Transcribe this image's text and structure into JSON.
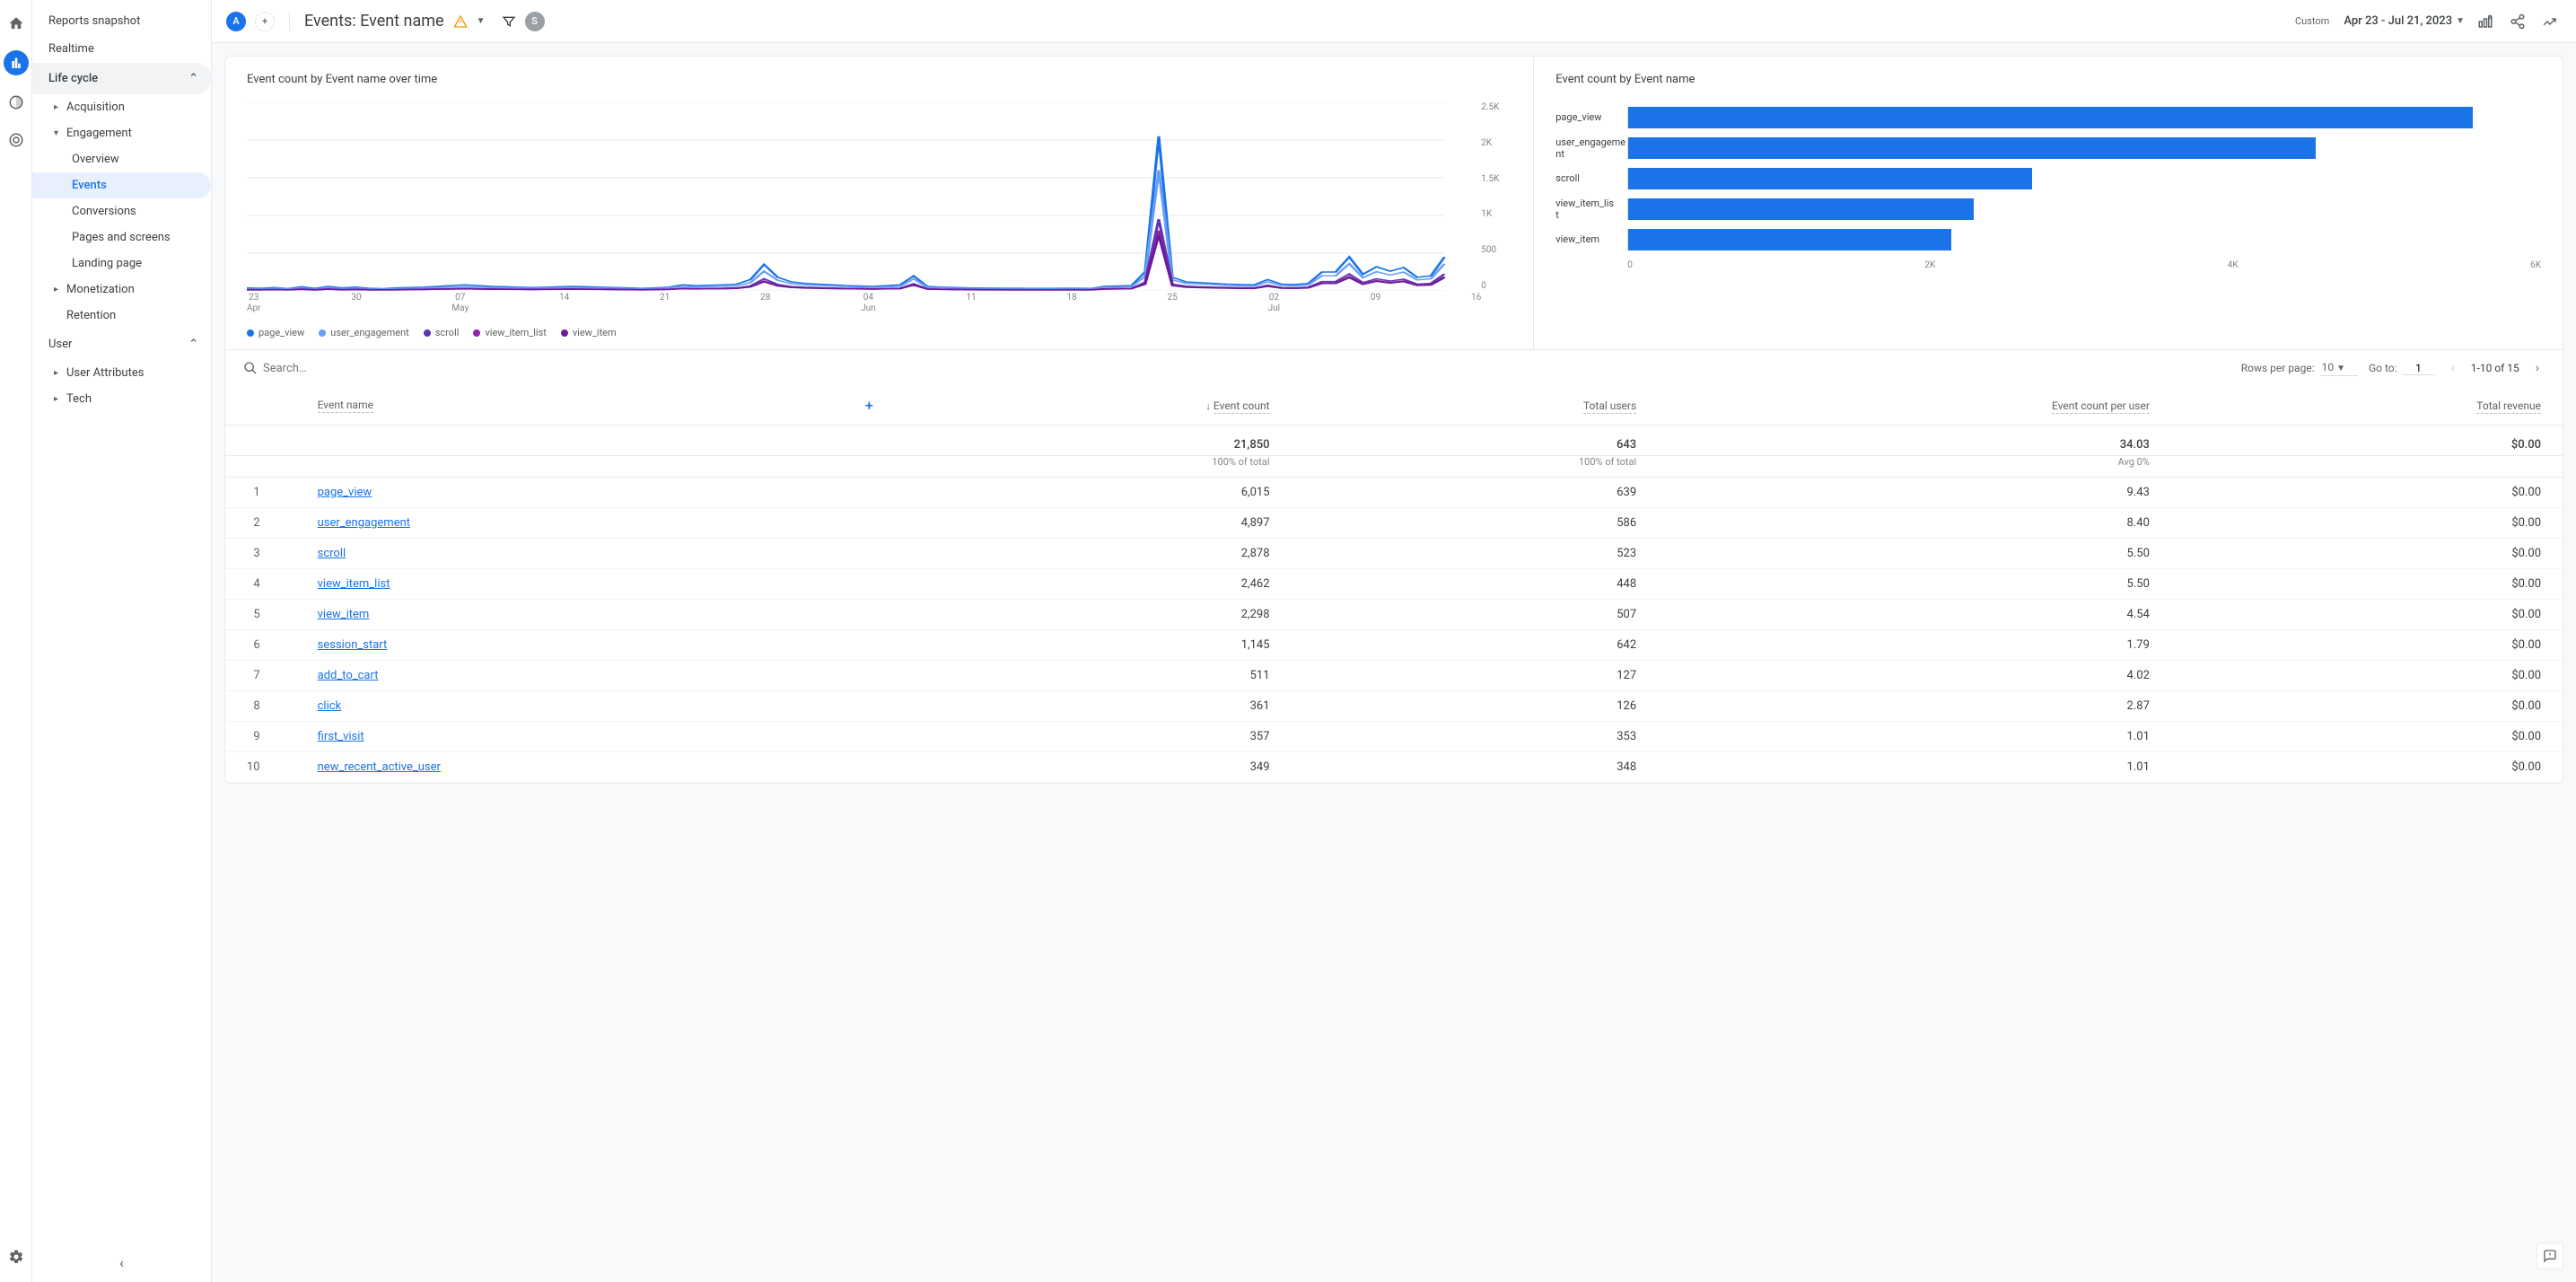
{
  "iconrail": {
    "home": "home-icon",
    "reports": "bar-chart-icon",
    "explore": "explore-icon",
    "ads": "target-icon",
    "settings": "gear-icon"
  },
  "sidebar": {
    "top": [
      "Reports snapshot",
      "Realtime"
    ],
    "sections": [
      {
        "label": "Life cycle",
        "expanded": true
      },
      {
        "label": "User",
        "expanded": true
      }
    ],
    "lifecycle_items": [
      {
        "label": "Acquisition",
        "has_children": true
      },
      {
        "label": "Engagement",
        "has_children": true,
        "expanded": true,
        "children": [
          {
            "label": "Overview"
          },
          {
            "label": "Events",
            "active": true
          },
          {
            "label": "Conversions"
          },
          {
            "label": "Pages and screens"
          },
          {
            "label": "Landing page"
          }
        ]
      },
      {
        "label": "Monetization",
        "has_children": true
      },
      {
        "label": "Retention",
        "has_children": false
      }
    ],
    "user_items": [
      {
        "label": "User Attributes",
        "has_children": true
      },
      {
        "label": "Tech",
        "has_children": true
      }
    ]
  },
  "header": {
    "chip_a": "A",
    "chip_s": "S",
    "title": "Events: Event name",
    "custom_label": "Custom",
    "date_range": "Apr 23 - Jul 21, 2023"
  },
  "line_chart": {
    "title": "Event count by Event name over time"
  },
  "bar_chart": {
    "title": "Event count by Event name"
  },
  "chart_data": [
    {
      "type": "line",
      "title": "Event count by Event name over time",
      "xlabel": "",
      "ylabel": "",
      "ylim": [
        0,
        2500
      ],
      "y_ticks": [
        "2.5K",
        "2K",
        "1.5K",
        "1K",
        "500",
        "0"
      ],
      "x_ticks": [
        {
          "d": "23",
          "m": "Apr"
        },
        {
          "d": "30",
          "m": ""
        },
        {
          "d": "07",
          "m": "May"
        },
        {
          "d": "14",
          "m": ""
        },
        {
          "d": "21",
          "m": ""
        },
        {
          "d": "28",
          "m": ""
        },
        {
          "d": "04",
          "m": "Jun"
        },
        {
          "d": "11",
          "m": ""
        },
        {
          "d": "18",
          "m": ""
        },
        {
          "d": "25",
          "m": ""
        },
        {
          "d": "02",
          "m": "Jul"
        },
        {
          "d": "09",
          "m": ""
        },
        {
          "d": "16",
          "m": ""
        }
      ],
      "legend_colors": {
        "page_view": "#1a73e8",
        "user_engagement": "#669df6",
        "scroll": "#5e35b1",
        "view_item_list": "#8e24aa",
        "view_item": "#6a1b9a"
      },
      "series": [
        {
          "name": "page_view",
          "color": "#1a73e8",
          "values": [
            40,
            35,
            45,
            30,
            55,
            35,
            60,
            40,
            50,
            35,
            30,
            40,
            45,
            50,
            60,
            70,
            80,
            70,
            60,
            55,
            50,
            45,
            50,
            55,
            60,
            55,
            50,
            45,
            40,
            35,
            40,
            50,
            80,
            70,
            75,
            80,
            90,
            150,
            350,
            180,
            120,
            100,
            90,
            80,
            70,
            65,
            60,
            70,
            80,
            200,
            60,
            50,
            45,
            40,
            38,
            36,
            35,
            34,
            33,
            32,
            35,
            34,
            33,
            60,
            65,
            70,
            250,
            2050,
            180,
            120,
            110,
            100,
            90,
            85,
            80,
            150,
            90,
            85,
            100,
            250,
            250,
            450,
            220,
            320,
            260,
            310,
            180,
            200,
            450
          ]
        },
        {
          "name": "user_engagement",
          "color": "#669df6",
          "values": [
            30,
            28,
            35,
            25,
            40,
            28,
            45,
            30,
            38,
            28,
            25,
            30,
            35,
            38,
            45,
            50,
            55,
            50,
            45,
            42,
            40,
            36,
            40,
            42,
            45,
            42,
            40,
            36,
            32,
            30,
            32,
            40,
            60,
            55,
            58,
            60,
            68,
            110,
            260,
            140,
            95,
            80,
            72,
            65,
            58,
            52,
            48,
            55,
            60,
            160,
            48,
            40,
            36,
            32,
            30,
            29,
            28,
            27,
            26,
            25,
            28,
            27,
            26,
            48,
            52,
            56,
            190,
            1600,
            145,
            100,
            90,
            82,
            74,
            68,
            64,
            120,
            72,
            68,
            80,
            200,
            200,
            360,
            175,
            255,
            210,
            250,
            145,
            160,
            360
          ]
        },
        {
          "name": "scroll",
          "color": "#5e35b1",
          "values": [
            18,
            17,
            20,
            15,
            25,
            17,
            28,
            18,
            23,
            17,
            15,
            18,
            21,
            23,
            28,
            30,
            33,
            30,
            27,
            25,
            24,
            22,
            24,
            25,
            27,
            25,
            24,
            22,
            20,
            18,
            20,
            24,
            36,
            33,
            35,
            36,
            41,
            66,
            160,
            85,
            58,
            49,
            44,
            39,
            35,
            32,
            29,
            33,
            36,
            95,
            29,
            24,
            22,
            20,
            18,
            18,
            17,
            17,
            16,
            15,
            17,
            17,
            16,
            29,
            32,
            34,
            115,
            950,
            90,
            62,
            55,
            50,
            46,
            42,
            40,
            75,
            45,
            42,
            50,
            124,
            124,
            224,
            110,
            160,
            130,
            155,
            90,
            100,
            225
          ]
        },
        {
          "name": "view_item_list",
          "color": "#8e24aa",
          "values": [
            15,
            14,
            17,
            13,
            21,
            14,
            23,
            15,
            19,
            14,
            13,
            15,
            18,
            19,
            23,
            25,
            27,
            25,
            22,
            21,
            20,
            18,
            20,
            21,
            22,
            21,
            20,
            18,
            17,
            15,
            17,
            20,
            30,
            27,
            29,
            30,
            34,
            55,
            130,
            70,
            48,
            41,
            37,
            33,
            29,
            27,
            25,
            28,
            30,
            80,
            25,
            20,
            18,
            17,
            15,
            15,
            14,
            14,
            13,
            13,
            14,
            14,
            13,
            25,
            27,
            29,
            95,
            800,
            75,
            52,
            46,
            42,
            39,
            36,
            34,
            64,
            38,
            36,
            42,
            105,
            105,
            190,
            93,
            136,
            110,
            132,
            77,
            85,
            190
          ]
        },
        {
          "name": "view_item",
          "color": "#6a1b9a",
          "values": [
            14,
            13,
            16,
            12,
            20,
            13,
            22,
            14,
            18,
            13,
            12,
            14,
            17,
            18,
            22,
            24,
            26,
            24,
            21,
            20,
            19,
            17,
            19,
            20,
            21,
            20,
            19,
            17,
            16,
            14,
            16,
            19,
            28,
            25,
            27,
            28,
            32,
            51,
            120,
            65,
            45,
            38,
            34,
            30,
            27,
            25,
            23,
            26,
            28,
            75,
            23,
            19,
            17,
            16,
            14,
            14,
            13,
            13,
            12,
            12,
            13,
            13,
            12,
            23,
            25,
            27,
            88,
            740,
            70,
            48,
            43,
            39,
            36,
            33,
            31,
            59,
            35,
            33,
            39,
            97,
            97,
            175,
            86,
            126,
            102,
            122,
            71,
            78,
            175
          ]
        }
      ]
    },
    {
      "type": "bar",
      "title": "Event count by Event name",
      "orientation": "horizontal",
      "xlim": [
        0,
        6500
      ],
      "x_ticks": [
        "0",
        "2K",
        "4K",
        "6K"
      ],
      "categories": [
        "page_view",
        "user_engagement",
        "scroll",
        "view_item_list",
        "view_item"
      ],
      "values": [
        6015,
        4897,
        2878,
        2462,
        2298
      ],
      "color": "#1a73e8"
    }
  ],
  "table_controls": {
    "search_placeholder": "Search…",
    "rows_per_page_label": "Rows per page:",
    "rows_per_page_value": "10",
    "go_to_label": "Go to:",
    "go_to_value": "1",
    "range_label": "1-10 of 15"
  },
  "table": {
    "columns": [
      "Event name",
      "Event count",
      "Total users",
      "Event count per user",
      "Total revenue"
    ],
    "sort_column": "Event count",
    "totals": {
      "event_count": "21,850",
      "total_users": "643",
      "per_user": "34.03",
      "revenue": "$0.00"
    },
    "totals_sub": {
      "event_count": "100% of total",
      "total_users": "100% of total",
      "per_user": "Avg 0%",
      "revenue": ""
    },
    "rows": [
      {
        "n": "1",
        "name": "page_view",
        "event_count": "6,015",
        "total_users": "639",
        "per_user": "9.43",
        "revenue": "$0.00"
      },
      {
        "n": "2",
        "name": "user_engagement",
        "event_count": "4,897",
        "total_users": "586",
        "per_user": "8.40",
        "revenue": "$0.00"
      },
      {
        "n": "3",
        "name": "scroll",
        "event_count": "2,878",
        "total_users": "523",
        "per_user": "5.50",
        "revenue": "$0.00"
      },
      {
        "n": "4",
        "name": "view_item_list",
        "event_count": "2,462",
        "total_users": "448",
        "per_user": "5.50",
        "revenue": "$0.00"
      },
      {
        "n": "5",
        "name": "view_item",
        "event_count": "2,298",
        "total_users": "507",
        "per_user": "4.54",
        "revenue": "$0.00"
      },
      {
        "n": "6",
        "name": "session_start",
        "event_count": "1,145",
        "total_users": "642",
        "per_user": "1.79",
        "revenue": "$0.00"
      },
      {
        "n": "7",
        "name": "add_to_cart",
        "event_count": "511",
        "total_users": "127",
        "per_user": "4.02",
        "revenue": "$0.00"
      },
      {
        "n": "8",
        "name": "click",
        "event_count": "361",
        "total_users": "126",
        "per_user": "2.87",
        "revenue": "$0.00"
      },
      {
        "n": "9",
        "name": "first_visit",
        "event_count": "357",
        "total_users": "353",
        "per_user": "1.01",
        "revenue": "$0.00"
      },
      {
        "n": "10",
        "name": "new_recent_active_user",
        "event_count": "349",
        "total_users": "348",
        "per_user": "1.01",
        "revenue": "$0.00"
      }
    ]
  }
}
